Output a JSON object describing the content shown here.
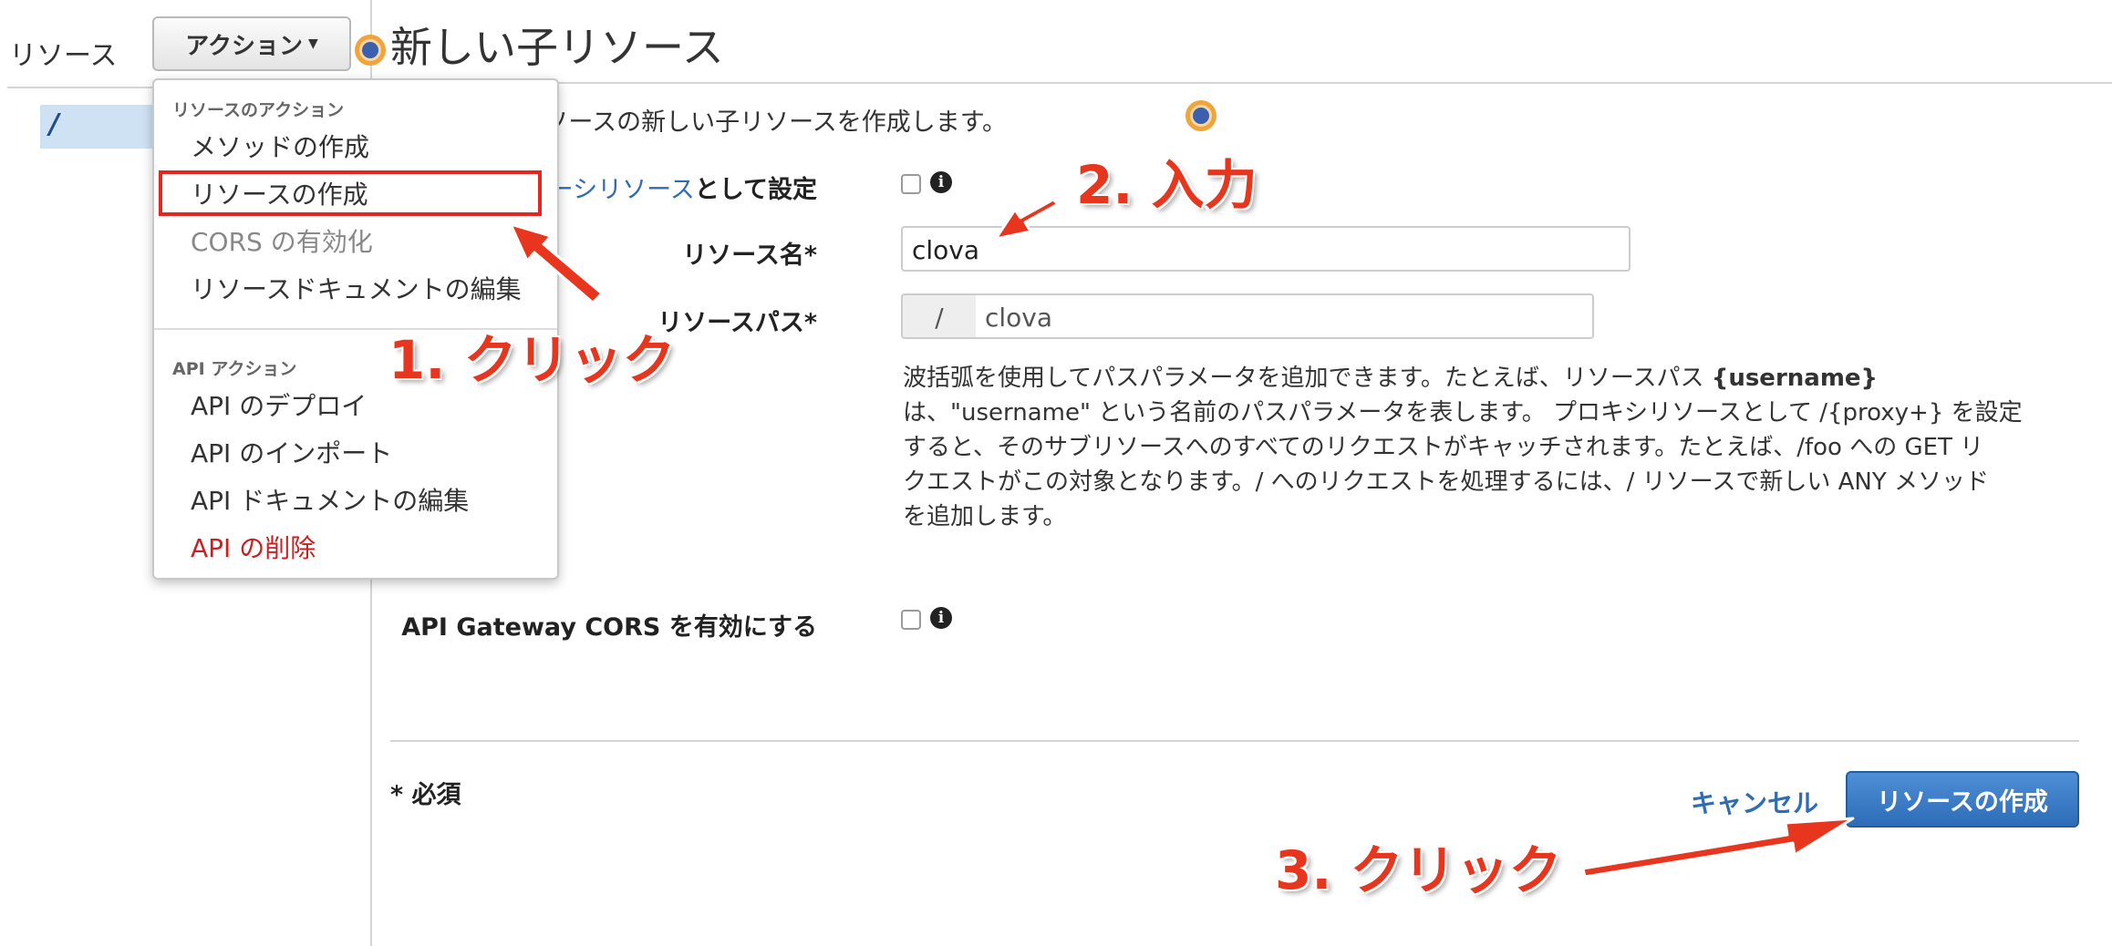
{
  "sidebar": {
    "title": "リソース",
    "root_resource": "/"
  },
  "toolbar": {
    "actions_label": "アクション"
  },
  "actions_menu": {
    "resource_section": "リソースのアクション",
    "resource_items": [
      "メソッドの作成",
      "リソースの作成",
      "CORS の有効化",
      "リソースドキュメントの編集"
    ],
    "api_section": "API アクション",
    "api_items": [
      "API のデプロイ",
      "API のインポート",
      "API ドキュメントの編集",
      "API の削除"
    ]
  },
  "form": {
    "title": "新しい子リソース",
    "description": "使用して、 リソースの新しい子リソースを作成します。",
    "proxy_label_link": "ーシリソース",
    "proxy_label_suffix": "として設定",
    "name_label": "リソース名*",
    "name_value": "clova",
    "path_label": "リソースパス*",
    "path_prefix": "/",
    "path_value": "clova",
    "path_help": {
      "line1_text": "波括弧を使用してパスパラメータを追加できます。たとえば、リソースパス ",
      "line1_bold": "{username}",
      "line2": "は、\"username\" という名前のパスパラメータを表します。 プロキシリソースとして /{proxy+} を設定",
      "line3": "すると、そのサブリソースへのすべてのリクエストがキャッチされます。たとえば、/foo への GET リ",
      "line4": "クエストがこの対象となります。/ へのリクエストを処理するには、/ リソースで新しい ANY メソッド",
      "line5": "を追加します。"
    },
    "cors_label": "API Gateway CORS を有効にする",
    "required_note": "* 必須",
    "cancel_label": "キャンセル",
    "create_label": "リソースの作成"
  },
  "annotations": {
    "step1": "1. クリック",
    "step2": "2. 入力",
    "step3": "3. クリック",
    "color": "#e8351e"
  },
  "colors": {
    "link": "#2e6db4",
    "primary_button": "#3a7bc8",
    "danger": "#cc2020",
    "highlight": "#e5251f"
  }
}
